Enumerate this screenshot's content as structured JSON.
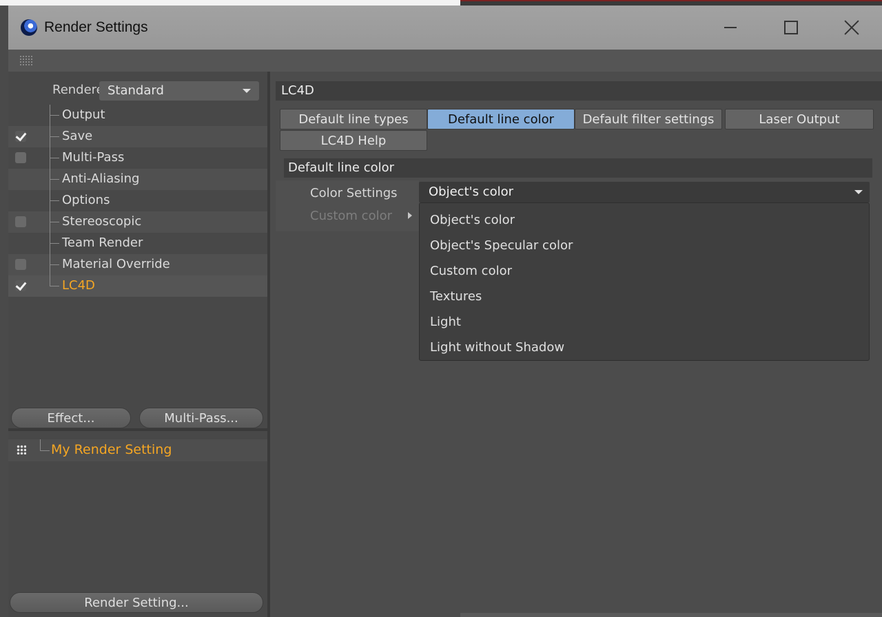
{
  "window": {
    "title": "Render Settings",
    "controls": {
      "minimize": "minimize-icon",
      "maximize": "maximize-icon",
      "close": "close-icon"
    }
  },
  "left": {
    "renderer_label": "Renderer",
    "renderer_value": "Standard",
    "tree": [
      {
        "label": "Output",
        "checkbox": "none"
      },
      {
        "label": "Save",
        "checkbox": "checked"
      },
      {
        "label": "Multi-Pass",
        "checkbox": "unchecked"
      },
      {
        "label": "Anti-Aliasing",
        "checkbox": "none"
      },
      {
        "label": "Options",
        "checkbox": "none"
      },
      {
        "label": "Stereoscopic",
        "checkbox": "unchecked"
      },
      {
        "label": "Team Render",
        "checkbox": "none"
      },
      {
        "label": "Material Override",
        "checkbox": "unchecked"
      },
      {
        "label": "LC4D",
        "checkbox": "checked",
        "selected": true
      }
    ],
    "effect_button": "Effect...",
    "multipass_button": "Multi-Pass...",
    "setting_name": "My Render Setting",
    "render_setting_button": "Render Setting..."
  },
  "right": {
    "section_title": "LC4D",
    "tabs": [
      {
        "label": "Default line types",
        "active": false
      },
      {
        "label": "Default line color",
        "active": true
      },
      {
        "label": "Default filter settings",
        "active": false
      },
      {
        "label": "Laser Output",
        "active": false
      },
      {
        "label": "LC4D Help",
        "active": false
      }
    ],
    "subsection_title": "Default line color",
    "color_settings_label": "Color Settings",
    "custom_color_label": "Custom color",
    "dropdown_value": "Object's color",
    "dropdown_options": [
      "Object's color",
      "Object's Specular color",
      "Custom color",
      "Textures",
      "Light",
      "Light without Shadow"
    ]
  },
  "colors": {
    "accent_orange": "#f5a623",
    "active_tab": "#84acd8",
    "panel": "#4a4a4a"
  }
}
